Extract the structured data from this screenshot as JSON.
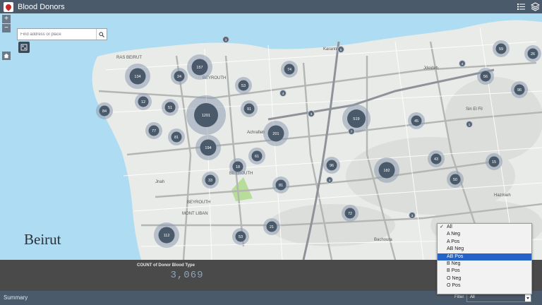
{
  "app": {
    "title": "Blood Donors"
  },
  "search": {
    "placeholder": "Find address or place"
  },
  "zoom": {
    "in": "+",
    "out": "−"
  },
  "map": {
    "city_label": "Beirut",
    "clusters": [
      {
        "label": "134",
        "size": "md"
      },
      {
        "label": "24",
        "size": "sm"
      },
      {
        "label": "157",
        "size": "md"
      },
      {
        "label": "74",
        "size": "sm"
      },
      {
        "label": "53",
        "size": "sm"
      },
      {
        "label": "98",
        "size": "sm"
      },
      {
        "label": "12",
        "size": "sm"
      },
      {
        "label": "51",
        "size": "sm"
      },
      {
        "label": "1201",
        "size": "xl"
      },
      {
        "label": "91",
        "size": "sm"
      },
      {
        "label": "84",
        "size": "sm"
      },
      {
        "label": "77",
        "size": "sm"
      },
      {
        "label": "81",
        "size": "sm"
      },
      {
        "label": "201",
        "size": "md"
      },
      {
        "label": "194",
        "size": "md"
      },
      {
        "label": "61",
        "size": "sm"
      },
      {
        "label": "18",
        "size": "sm"
      },
      {
        "label": "519",
        "size": "lg"
      },
      {
        "label": "45",
        "size": "sm"
      },
      {
        "label": "96",
        "size": "sm"
      },
      {
        "label": "43",
        "size": "sm"
      },
      {
        "label": "182",
        "size": "md"
      },
      {
        "label": "50",
        "size": "sm"
      },
      {
        "label": "15",
        "size": "sm"
      },
      {
        "label": "33",
        "size": "sm"
      },
      {
        "label": "81",
        "size": "sm"
      },
      {
        "label": "59",
        "size": "sm"
      },
      {
        "label": "26",
        "size": "sm"
      },
      {
        "label": "56",
        "size": "sm"
      },
      {
        "label": "96",
        "size": "sm"
      },
      {
        "label": "72",
        "size": "sm"
      },
      {
        "label": "112",
        "size": "md"
      },
      {
        "label": "53",
        "size": "sm"
      },
      {
        "label": "21",
        "size": "sm"
      }
    ],
    "points": [
      "3",
      "5",
      "4",
      "4",
      "3",
      "7",
      "1",
      "4",
      "3"
    ],
    "place_labels": [
      {
        "text": "BEYROUTH"
      },
      {
        "text": "BEYROUTH"
      },
      {
        "text": "BEYROUTH"
      },
      {
        "text": "RAS BEIRUT"
      },
      {
        "text": "MONT LIBAN"
      },
      {
        "text": "Achrafieh"
      },
      {
        "text": "Karantina"
      },
      {
        "text": "Jdeideh"
      },
      {
        "text": "Sin El Fil"
      },
      {
        "text": "Hazmieh"
      },
      {
        "text": "Jnah"
      },
      {
        "text": "Bachoura"
      }
    ]
  },
  "stats": {
    "title": "COUNT of Donor Blood Type",
    "value": "3,069"
  },
  "footer": {
    "summary_label": "Summary",
    "filter_label": "Filter",
    "filter_value": "All"
  },
  "dropdown": {
    "options": [
      "All",
      "A Neg",
      "A Pos",
      "AB Neg",
      "AB Pos",
      "B Neg",
      "B Pos",
      "O Neg",
      "O Pos"
    ],
    "checked": "All",
    "highlighted": "AB Pos"
  },
  "colors": {
    "bar": "#4b5a6a",
    "water": "#aedcf2",
    "land": "#e9ebe8",
    "cluster": "#4b5a6a",
    "cluster_halo": "#8e9db0",
    "highlight": "#2563c9",
    "park": "#b7dd9a"
  }
}
